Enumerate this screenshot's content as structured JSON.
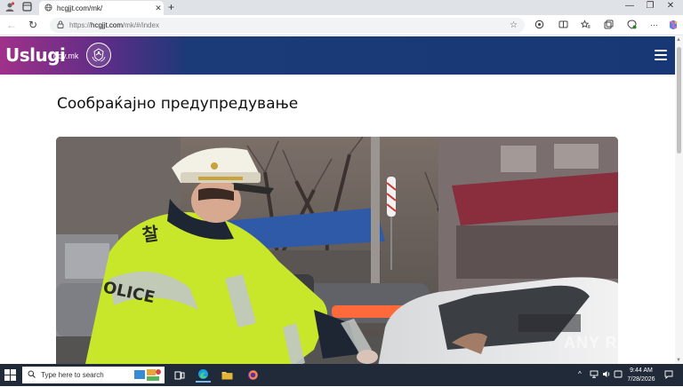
{
  "browser": {
    "tab_title": "hcgjjt.com/mk/",
    "url_prefix": "https://",
    "url_host": "hcgjjt.com",
    "url_path": "/mk/#/index"
  },
  "site": {
    "logo_text": "Uslugi",
    "logo_suffix": "gov.mk",
    "page_title": "Сообраќајно предупредување"
  },
  "hero": {
    "vest_text_1": "찰",
    "vest_text_2": "OLICE"
  },
  "watermark": "ANY RUN",
  "taskbar": {
    "search_placeholder": "Type here to search",
    "time": "9:44 AM",
    "date": "7/28/2026"
  },
  "colors": {
    "header_start": "#a0318a",
    "header_end": "#173875",
    "vest": "#c8e62a"
  }
}
